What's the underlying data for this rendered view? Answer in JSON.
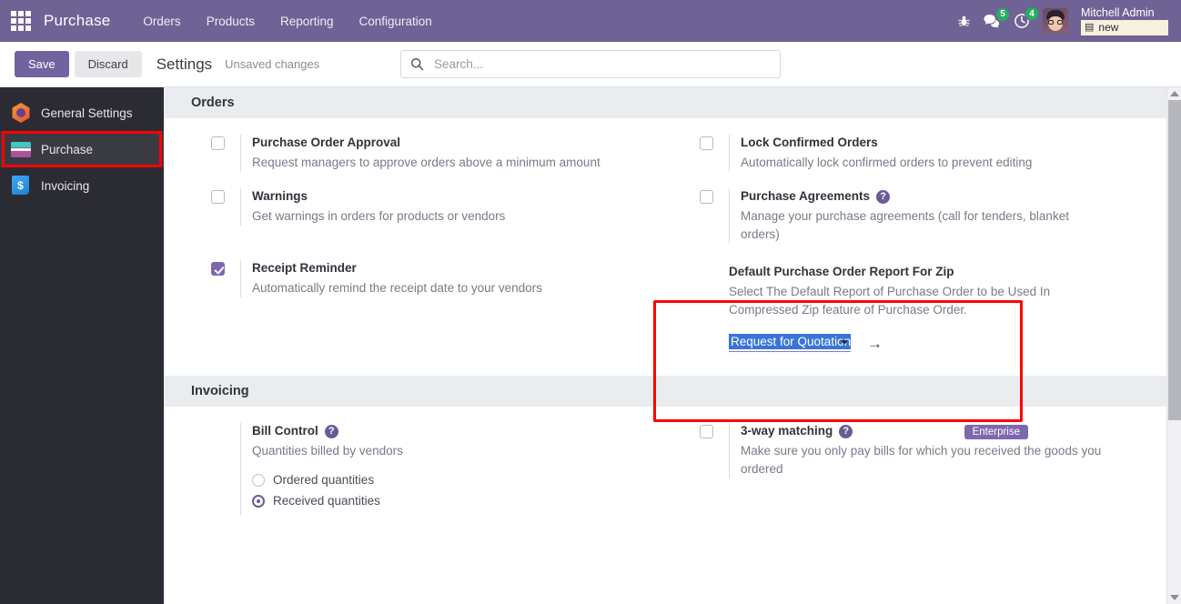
{
  "navbar": {
    "apps_icon": "apps-grid-icon",
    "brand": "Purchase",
    "menu": [
      {
        "label": "Orders"
      },
      {
        "label": "Products"
      },
      {
        "label": "Reporting"
      },
      {
        "label": "Configuration"
      }
    ],
    "right": {
      "bug_icon": "bug-icon",
      "messages_icon": "chat-bubble-icon",
      "messages_count": "5",
      "activities_icon": "clock-icon",
      "activities_count": "4",
      "avatar": "user-avatar",
      "user_name": "Mitchell Admin",
      "database_icon": "database-icon",
      "database_name": "new"
    },
    "colors": {
      "background": "#6f6295",
      "badge": "#27ae60",
      "chip_bg": "#f7f0dd"
    }
  },
  "control_panel": {
    "save_label": "Save",
    "discard_label": "Discard",
    "title": "Settings",
    "status": "Unsaved changes",
    "search": {
      "icon": "search-icon",
      "value": "",
      "placeholder": "Search..."
    }
  },
  "sidebar": {
    "items": [
      {
        "label": "General Settings",
        "icon": "general-settings-icon",
        "active": false
      },
      {
        "label": "Purchase",
        "icon": "purchase-icon",
        "active": true
      },
      {
        "label": "Invoicing",
        "icon": "invoicing-icon",
        "active": false
      }
    ]
  },
  "sections": {
    "orders": {
      "header": "Orders",
      "purchase_order_approval": {
        "title": "Purchase Order Approval",
        "desc": "Request managers to approve orders above a minimum amount",
        "checked": false
      },
      "lock_confirmed_orders": {
        "title": "Lock Confirmed Orders",
        "desc": "Automatically lock confirmed orders to prevent editing",
        "checked": false
      },
      "warnings": {
        "title": "Warnings",
        "desc": "Get warnings in orders for products or vendors",
        "checked": false
      },
      "purchase_agreements": {
        "title": "Purchase Agreements",
        "help_icon": "question-mark-icon",
        "desc": "Manage your purchase agreements (call for tenders, blanket orders)",
        "checked": false
      },
      "receipt_reminder": {
        "title": "Receipt Reminder",
        "desc": "Automatically remind the receipt date to your vendors",
        "checked": true
      },
      "default_po_report_zip": {
        "title": "Default Purchase Order Report For Zip",
        "desc": "Select The Default Report of Purchase Order to be Used In Compressed Zip feature of Purchase Order.",
        "selected_option": "Request for Quotation",
        "dropdown_icon": "chevron-down-icon",
        "internal_link_icon": "arrow-right-icon",
        "highlighted": true
      }
    },
    "invoicing": {
      "header": "Invoicing",
      "bill_control": {
        "title": "Bill Control",
        "help_icon": "question-mark-icon",
        "desc": "Quantities billed by vendors",
        "options": [
          {
            "label": "Ordered quantities",
            "selected": false
          },
          {
            "label": "Received quantities",
            "selected": true
          }
        ]
      },
      "three_way_matching": {
        "title": "3-way matching",
        "help_icon": "question-mark-icon",
        "desc": "Make sure you only pay bills for which you received the goods you ordered",
        "badge": "Enterprise",
        "checked": false
      }
    }
  },
  "scrollbar": {
    "up_icon": "triangle-up-icon",
    "down_icon": "triangle-down-icon",
    "thumb": "scroll-thumb"
  },
  "annotations": {
    "sidebar_highlight": "red-rectangle-purchase",
    "zip_highlight": "red-rectangle-default-po-report"
  }
}
